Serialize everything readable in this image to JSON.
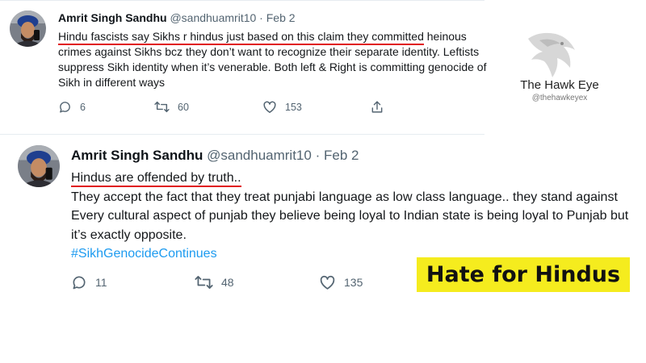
{
  "tweets": [
    {
      "author_name": "Amrit Singh Sandhu",
      "handle": "@sandhuamrit10",
      "separator": "·",
      "date": "Feb 2",
      "text_underlined": "Hindu fascists say Sikhs r hindus just based on this claim they committed",
      "text_rest": " heinous crimes against Sikhs bcz they don’t want to recognize their separate identity. Leftists suppress Sikh identity when it’s venerable. Both left & Right is committing genocide of Sikh in different ways",
      "replies": "6",
      "retweets": "60",
      "likes": "153"
    },
    {
      "author_name": "Amrit Singh Sandhu",
      "handle": "@sandhuamrit10",
      "separator": "·",
      "date": "Feb 2",
      "text_underlined": "Hindus are offended by truth..",
      "text_rest": "They accept the fact that they treat punjabi language as low class language.. they stand against Every cultural aspect of punjab they believe being loyal to Indian state is being loyal to Punjab but it’s exactly opposite.",
      "hashtag": "#SikhGenocideContinues",
      "replies": "11",
      "retweets": "48",
      "likes": "135"
    }
  ],
  "watermark": {
    "title": "The Hawk Eye",
    "handle": "@thehawkeyex"
  },
  "banner": {
    "text": "Hate for Hindus",
    "background": "#f5ec1e"
  },
  "colors": {
    "underline": "#e0141b",
    "hashtag": "#1d9bf0",
    "muted": "#536471"
  },
  "icons": [
    "reply-icon",
    "retweet-icon",
    "like-icon",
    "share-icon",
    "eagle-icon"
  ]
}
